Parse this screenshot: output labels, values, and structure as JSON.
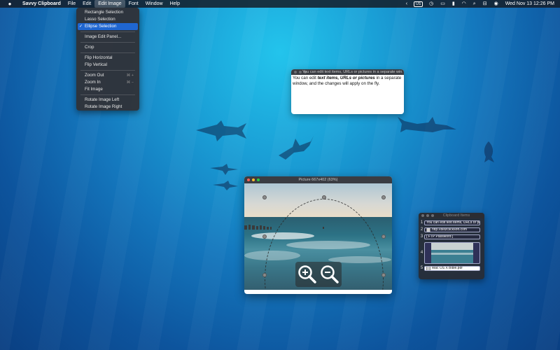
{
  "menubar": {
    "app": "Savvy Clipboard",
    "menus": [
      "File",
      "Edit",
      "Edit Image",
      "Font",
      "Window",
      "Help"
    ],
    "active_menu": "Edit Image",
    "status": {
      "input_source": "US",
      "clock": "Wed Nov 13  12:26 PM"
    }
  },
  "edit_image_menu": {
    "items": [
      {
        "label": "Rectangle Selection"
      },
      {
        "label": "Lasso Selection"
      },
      {
        "label": "Ellipse Selection",
        "checked": true,
        "selected": true
      },
      {
        "label": "Image Edit Panel..."
      },
      {
        "label": "Crop"
      },
      {
        "label": "Flip Horizontal"
      },
      {
        "label": "Flip Vertical"
      },
      {
        "label": "Zoom Out",
        "shortcut": "⌘ +"
      },
      {
        "label": "Zoom In",
        "shortcut": "⌘ −"
      },
      {
        "label": "Fit Image"
      },
      {
        "label": "Rotate Image Left"
      },
      {
        "label": "Rotate Image Right"
      }
    ]
  },
  "editor_window": {
    "title": "You can edit text items, URLs or pictures in a separate win...",
    "text_before": "You can edit ",
    "text_emphasis": "text items, URLs or pictures",
    "text_after": " in a separate window, and the changes will apply on the fly."
  },
  "picture_window": {
    "title": "Picture 667x402 (63%)"
  },
  "clipboard_items": {
    "title": "Clipboard Items",
    "items": [
      {
        "num": "1",
        "text": "You can edit text items, URLs or pictu..."
      },
      {
        "num": "2",
        "text": "http://blitzclicksoft.com"
      },
      {
        "num": "3",
        "text": "[ FTP Password ]"
      },
      {
        "num": "4",
        "text": ""
      },
      {
        "num": "5",
        "text": "Mac OS X Bible.pdf"
      }
    ]
  }
}
